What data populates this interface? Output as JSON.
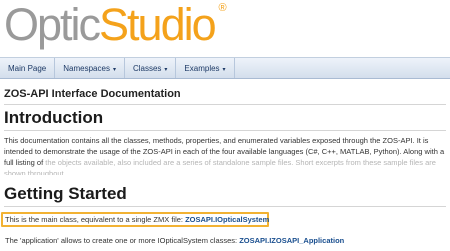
{
  "logo": {
    "part1": "Optic",
    "part2": "Studio",
    "mark": "®"
  },
  "nav": [
    {
      "label": "Main Page",
      "dropdown": false
    },
    {
      "label": "Namespaces",
      "dropdown": true
    },
    {
      "label": "Classes",
      "dropdown": true
    },
    {
      "label": "Examples",
      "dropdown": true
    }
  ],
  "caret": "▾",
  "page_title": "ZOS-API Interface Documentation",
  "intro": {
    "heading": "Introduction",
    "text": "This documentation contains all the classes, methods, properties, and enumerated variables exposed through the ZOS-API. It is intended to demonstrate the usage of the ZOS-API in each of the four available languages (C#, C++, MATLAB, Python). Along with a full listing of",
    "text_faded": "the objects available, also included are a series of standalone sample files. Short excerpts from these sample files are shown throughout"
  },
  "getting_started": {
    "heading": "Getting Started",
    "line1_text": "This is the main class, equivalent to a single ZMX file: ",
    "line1_link": "ZOSAPI.IOpticalSystem",
    "line2_text": "The 'application' allows to create one or more IOpticalSystem classes: ",
    "line2_link": "ZOSAPI.IZOSAPI_Application"
  },
  "colors": {
    "accent": "#f4a21b",
    "link": "#1a4f8f",
    "highlight_border": "#f2b233"
  }
}
